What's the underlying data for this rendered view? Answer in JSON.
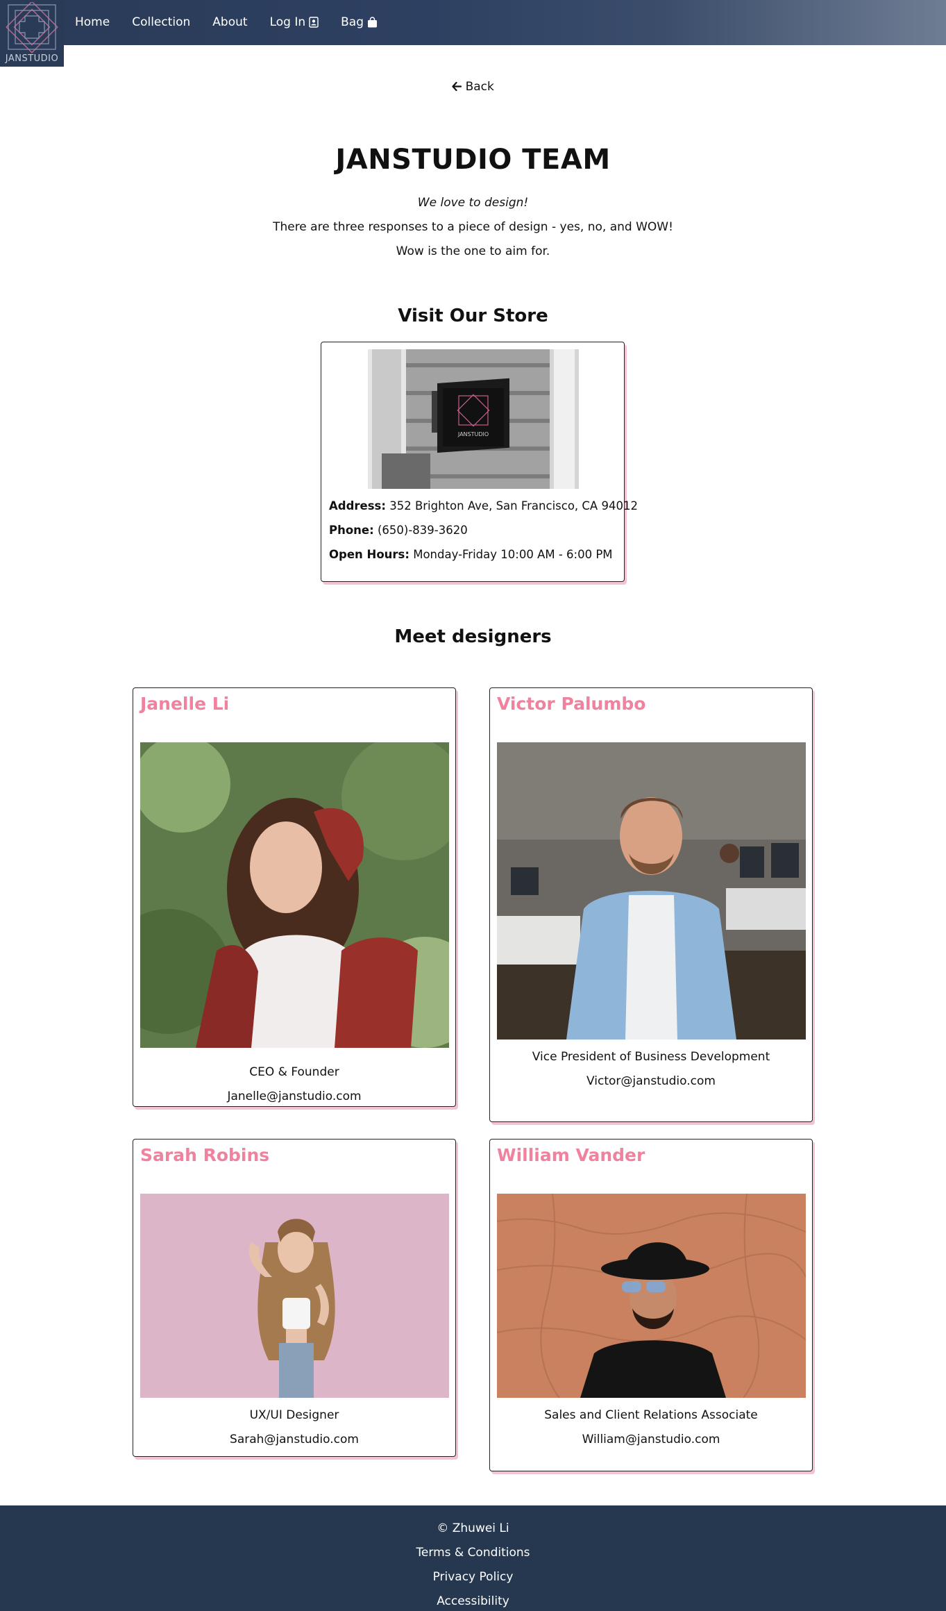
{
  "brand": {
    "logo_text": "JANSTUDIO"
  },
  "nav": {
    "home": "Home",
    "collection": "Collection",
    "about": "About",
    "login": "Log In",
    "bag": "Bag"
  },
  "back": {
    "label": "Back"
  },
  "page": {
    "title": "JANSTUDIO TEAM",
    "tagline": "We love to design!",
    "intro_line1": "There are three responses to a piece of design - yes, no, and WOW!",
    "intro_line2": "Wow is the one to aim for."
  },
  "store": {
    "section_title": "Visit Our Store",
    "sign_text": "JANSTUDIO",
    "address_label": "Address:",
    "address": "352 Brighton Ave, San Francisco, CA 94012",
    "phone_label": "Phone:",
    "phone": "(650)-839-3620",
    "hours_label": "Open Hours:",
    "hours": "Monday-Friday 10:00 AM - 6:00 PM"
  },
  "designers": {
    "section_title": "Meet designers",
    "items": [
      {
        "name": "Janelle Li",
        "role": "CEO & Founder",
        "email": "Janelle@janstudio.com"
      },
      {
        "name": "Victor Palumbo",
        "role": "Vice President of Business Development",
        "email": "Victor@janstudio.com"
      },
      {
        "name": "Sarah Robins",
        "role": "UX/UI Designer",
        "email": "Sarah@janstudio.com"
      },
      {
        "name": "William Vander",
        "role": "Sales and Client Relations Associate",
        "email": "William@janstudio.com"
      }
    ]
  },
  "footer": {
    "copyright": "© Zhuwei Li",
    "terms": "Terms & Conditions",
    "privacy": "Privacy Policy",
    "accessibility": "Accessibility"
  },
  "icons": {
    "back": "arrow-left-icon",
    "login": "person-badge-icon",
    "bag": "shopping-bag-icon"
  },
  "colors": {
    "nav_bg": "#2a3b58",
    "footer_bg": "#263750",
    "accent_pink": "#f0829e",
    "card_shadow": "#f3c3d3"
  }
}
